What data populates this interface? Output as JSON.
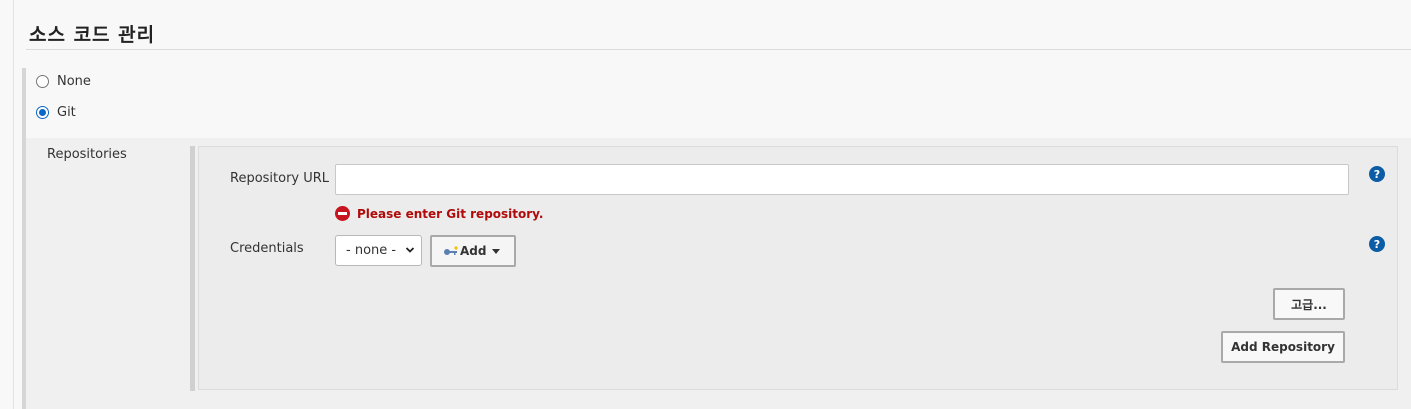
{
  "section": {
    "title": "소스 코드 관리"
  },
  "scm_options": [
    {
      "label": "None",
      "selected": false
    },
    {
      "label": "Git",
      "selected": true
    }
  ],
  "git": {
    "repositories_label": "Repositories",
    "repository_url": {
      "label": "Repository URL",
      "value": "",
      "error": "Please enter Git repository."
    },
    "credentials": {
      "label": "Credentials",
      "selected": "- none -",
      "add_label": "Add"
    },
    "advanced_label": "고급...",
    "add_repository_label": "Add Repository"
  },
  "icons": {
    "help": "help-icon",
    "error": "error-icon",
    "key": "key-icon",
    "chevron": "chevron-down-icon",
    "caret": "caret-down-icon"
  },
  "colors": {
    "accent": "#0a66c8",
    "help": "#0d5ca6",
    "error": "#b00a0a"
  }
}
